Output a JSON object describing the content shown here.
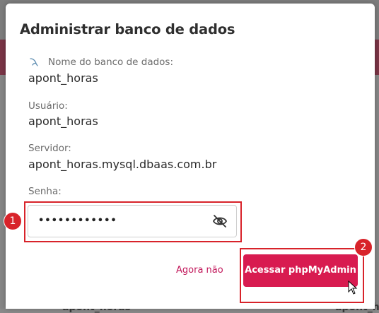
{
  "backdrop": {
    "left_text": "apont_horas",
    "right_text": "apont_h"
  },
  "dialog": {
    "title": "Administrar banco de dados",
    "fields": [
      {
        "label": "Nome do banco de dados:",
        "value": "apont_horas"
      },
      {
        "label": "Usuário:",
        "value": "apont_horas"
      },
      {
        "label": "Servidor:",
        "value": "apont_horas.mysql.dbaas.com.br"
      }
    ],
    "password": {
      "label": "Senha:",
      "value": "••••••••••••"
    },
    "cancel_label": "Agora não",
    "primary_label": "Acessar phpMyAdmin",
    "badges": [
      "1",
      "2"
    ],
    "colors": {
      "accent": "#d81b50",
      "highlight": "#d8232a"
    },
    "icons": {
      "db": "mysql-dolphin-icon",
      "toggle": "eye-slash-icon"
    }
  }
}
